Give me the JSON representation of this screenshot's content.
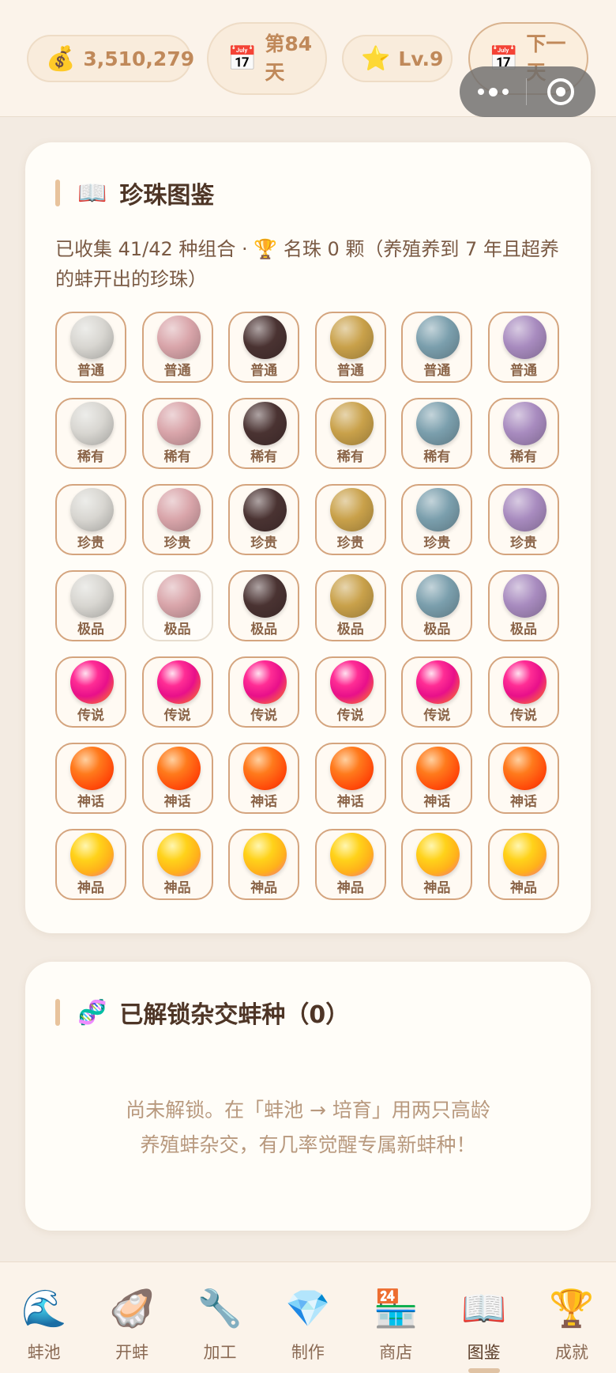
{
  "header": {
    "coins": {
      "icon": "💰",
      "value": "3,510,279"
    },
    "day": {
      "icon": "📅",
      "label": "第84天"
    },
    "level": {
      "icon": "⭐",
      "label": "Lv.9"
    },
    "next_day": {
      "icon": "📅",
      "label": "下一天"
    }
  },
  "gallery": {
    "title_icon": "📖",
    "title": "珍珠图鉴",
    "summary": "已收集 41/42 种组合 · 🏆 名珠 0 颗（养殖养到 7 年且超养的蚌开出的珍珠）",
    "colors": {
      "white": "#d8d6d1",
      "pink": "#d9a5aa",
      "black": "#4a3332",
      "gold": "#c9a14a",
      "blue": "#7b9fad",
      "purple": "#a88bbf",
      "legend": "#f0208a",
      "myth": "#ff6a10",
      "divine": "#ffd21a"
    },
    "rows": [
      {
        "grade": "普通",
        "cells": [
          {
            "color": "white",
            "owned": true
          },
          {
            "color": "pink",
            "owned": true
          },
          {
            "color": "black",
            "owned": true
          },
          {
            "color": "gold",
            "owned": true
          },
          {
            "color": "blue",
            "owned": true
          },
          {
            "color": "purple",
            "owned": true
          }
        ]
      },
      {
        "grade": "稀有",
        "cells": [
          {
            "color": "white",
            "owned": true
          },
          {
            "color": "pink",
            "owned": true
          },
          {
            "color": "black",
            "owned": true
          },
          {
            "color": "gold",
            "owned": true
          },
          {
            "color": "blue",
            "owned": true
          },
          {
            "color": "purple",
            "owned": true
          }
        ]
      },
      {
        "grade": "珍贵",
        "cells": [
          {
            "color": "white",
            "owned": true
          },
          {
            "color": "pink",
            "owned": true
          },
          {
            "color": "black",
            "owned": true
          },
          {
            "color": "gold",
            "owned": true
          },
          {
            "color": "blue",
            "owned": true
          },
          {
            "color": "purple",
            "owned": true
          }
        ]
      },
      {
        "grade": "极品",
        "cells": [
          {
            "color": "white",
            "owned": true
          },
          {
            "color": "pink",
            "owned": false
          },
          {
            "color": "black",
            "owned": true
          },
          {
            "color": "gold",
            "owned": true
          },
          {
            "color": "blue",
            "owned": true
          },
          {
            "color": "purple",
            "owned": true
          }
        ]
      },
      {
        "grade": "传说",
        "cells": [
          {
            "color": "legend",
            "owned": true
          },
          {
            "color": "legend",
            "owned": true
          },
          {
            "color": "legend",
            "owned": true
          },
          {
            "color": "legend",
            "owned": true
          },
          {
            "color": "legend",
            "owned": true
          },
          {
            "color": "legend",
            "owned": true
          }
        ]
      },
      {
        "grade": "神话",
        "cells": [
          {
            "color": "myth",
            "owned": true
          },
          {
            "color": "myth",
            "owned": true
          },
          {
            "color": "myth",
            "owned": true
          },
          {
            "color": "myth",
            "owned": true
          },
          {
            "color": "myth",
            "owned": true
          },
          {
            "color": "myth",
            "owned": true
          }
        ]
      },
      {
        "grade": "神品",
        "cells": [
          {
            "color": "divine",
            "owned": true
          },
          {
            "color": "divine",
            "owned": true
          },
          {
            "color": "divine",
            "owned": true
          },
          {
            "color": "divine",
            "owned": true
          },
          {
            "color": "divine",
            "owned": true
          },
          {
            "color": "divine",
            "owned": true
          }
        ]
      }
    ]
  },
  "hybrid": {
    "title_icon": "🧬",
    "title": "已解锁杂交蚌种（0）",
    "empty_line1": "尚未解锁。在「蚌池 → 培育」用两只高龄",
    "empty_line2": "养殖蚌杂交，有几率觉醒专属新蚌种！"
  },
  "nav": [
    {
      "icon": "🌊",
      "icon_name": "wave-icon",
      "label": "蚌池",
      "active": false
    },
    {
      "icon": "🦪",
      "icon_name": "oyster-icon",
      "label": "开蚌",
      "active": false
    },
    {
      "icon": "🔧",
      "icon_name": "wrench-icon",
      "label": "加工",
      "active": false
    },
    {
      "icon": "💎",
      "icon_name": "gem-icon",
      "label": "制作",
      "active": false
    },
    {
      "icon": "🏪",
      "icon_name": "store-icon",
      "label": "商店",
      "active": false
    },
    {
      "icon": "📖",
      "icon_name": "book-icon",
      "label": "图鉴",
      "active": true
    },
    {
      "icon": "🏆",
      "icon_name": "trophy-icon",
      "label": "成就",
      "active": false
    }
  ]
}
